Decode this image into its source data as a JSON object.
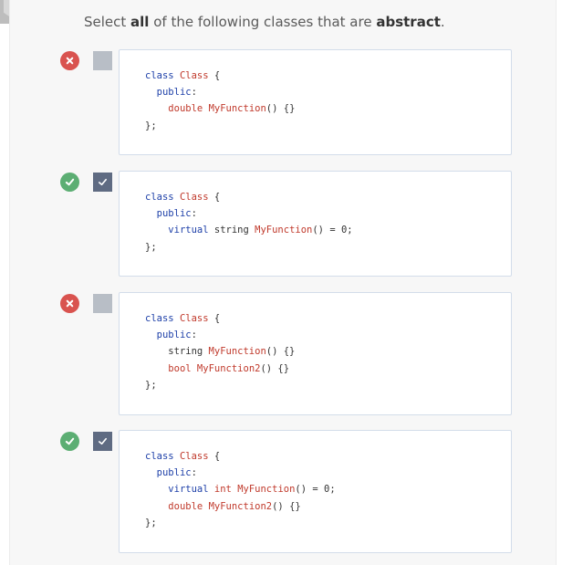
{
  "prompt": {
    "pre": "Select ",
    "bold1": "all",
    "mid": " of the following classes that are ",
    "bold2": "abstract",
    "post": "."
  },
  "colors": {
    "correct": "#5cae73",
    "incorrect": "#d9534f",
    "checked": "#5f6b82",
    "unchecked": "#b8bec6"
  },
  "options": [
    {
      "status": "incorrect",
      "checked": false,
      "lines": [
        [
          {
            "t": "class",
            "c": "kw"
          },
          {
            "t": " "
          },
          {
            "t": "Class",
            "c": "fn"
          },
          {
            "t": " {"
          }
        ],
        [
          {
            "t": "  "
          },
          {
            "t": "public",
            "c": "kw"
          },
          {
            "t": ":"
          }
        ],
        [
          {
            "t": "    "
          },
          {
            "t": "double",
            "c": "fn"
          },
          {
            "t": " "
          },
          {
            "t": "MyFunction",
            "c": "fn"
          },
          {
            "t": "() {}"
          }
        ],
        [
          {
            "t": "};"
          }
        ]
      ]
    },
    {
      "status": "correct",
      "checked": true,
      "lines": [
        [
          {
            "t": "class",
            "c": "kw"
          },
          {
            "t": " "
          },
          {
            "t": "Class",
            "c": "fn"
          },
          {
            "t": " {"
          }
        ],
        [
          {
            "t": "  "
          },
          {
            "t": "public",
            "c": "kw"
          },
          {
            "t": ":"
          }
        ],
        [
          {
            "t": "    "
          },
          {
            "t": "virtual",
            "c": "kw"
          },
          {
            "t": " string "
          },
          {
            "t": "MyFunction",
            "c": "fn"
          },
          {
            "t": "() = 0;"
          }
        ],
        [
          {
            "t": "};"
          }
        ]
      ]
    },
    {
      "status": "incorrect",
      "checked": false,
      "lines": [
        [
          {
            "t": "class",
            "c": "kw"
          },
          {
            "t": " "
          },
          {
            "t": "Class",
            "c": "fn"
          },
          {
            "t": " {"
          }
        ],
        [
          {
            "t": "  "
          },
          {
            "t": "public",
            "c": "kw"
          },
          {
            "t": ":"
          }
        ],
        [
          {
            "t": "    string "
          },
          {
            "t": "MyFunction",
            "c": "fn"
          },
          {
            "t": "() {}"
          }
        ],
        [
          {
            "t": "    "
          },
          {
            "t": "bool",
            "c": "fn"
          },
          {
            "t": " "
          },
          {
            "t": "MyFunction2",
            "c": "fn"
          },
          {
            "t": "() {}"
          }
        ],
        [
          {
            "t": "};"
          }
        ]
      ]
    },
    {
      "status": "correct",
      "checked": true,
      "lines": [
        [
          {
            "t": "class",
            "c": "kw"
          },
          {
            "t": " "
          },
          {
            "t": "Class",
            "c": "fn"
          },
          {
            "t": " {"
          }
        ],
        [
          {
            "t": "  "
          },
          {
            "t": "public",
            "c": "kw"
          },
          {
            "t": ":"
          }
        ],
        [
          {
            "t": "    "
          },
          {
            "t": "virtual",
            "c": "kw"
          },
          {
            "t": " "
          },
          {
            "t": "int",
            "c": "fn"
          },
          {
            "t": " "
          },
          {
            "t": "MyFunction",
            "c": "fn"
          },
          {
            "t": "() = 0;"
          }
        ],
        [
          {
            "t": "    "
          },
          {
            "t": "double",
            "c": "fn"
          },
          {
            "t": " "
          },
          {
            "t": "MyFunction2",
            "c": "fn"
          },
          {
            "t": "() {}"
          }
        ],
        [
          {
            "t": "};"
          }
        ]
      ]
    }
  ]
}
